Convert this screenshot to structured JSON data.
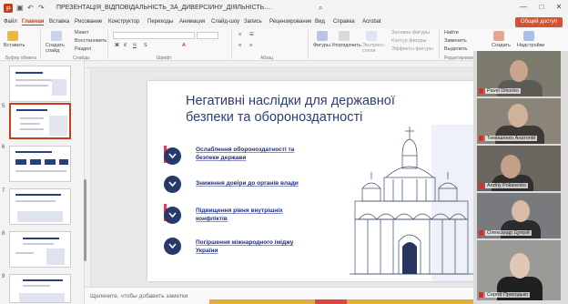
{
  "window": {
    "title": "ПРЕЗЕНТАЦІЯ_ВІДПОВІДАЛЬНІСТЬ_ЗА_ДИВЕРСІЙНУ_ДІЯЛЬНІСТЬ.pptx • PowerP..."
  },
  "tabs": [
    {
      "label": "Файл"
    },
    {
      "label": "Главная"
    },
    {
      "label": "Вставка"
    },
    {
      "label": "Рисование"
    },
    {
      "label": "Конструктор"
    },
    {
      "label": "Переходы"
    },
    {
      "label": "Анимация"
    },
    {
      "label": "Слайд-шоу"
    },
    {
      "label": "Запись"
    },
    {
      "label": "Рецензирование"
    },
    {
      "label": "Вид"
    },
    {
      "label": "Справка"
    },
    {
      "label": "Acrobat"
    }
  ],
  "share_label": "Общий доступ",
  "ribbon": {
    "paste": "Вставить",
    "new_slide": "Создать слайд",
    "layout": "Макет",
    "reset": "Восстановить",
    "section": "Раздел",
    "shapes": "Фигуры",
    "arrange": "Упорядочить",
    "express_styles": "Экспресс-стили",
    "shape_fill": "Заливка фигуры",
    "shape_outline": "Контур фигуры",
    "shape_effects": "Эффекты фигуры",
    "find": "Найти",
    "replace": "Заменить",
    "select": "Выделить",
    "create": "Создать",
    "addins": "Надстройки",
    "groups": {
      "clipboard": "Буфер обмена",
      "slides": "Слайды",
      "font": "Шрифт",
      "paragraph": "Абзац",
      "editing": "Редактирование"
    }
  },
  "thumbnails": [
    {
      "num": "5"
    },
    {
      "num": "6"
    },
    {
      "num": "7"
    },
    {
      "num": "8"
    },
    {
      "num": "9"
    }
  ],
  "slide": {
    "title": "Негативні наслідки для державної безпеки та обороноздатності",
    "items": [
      {
        "text": "Ослаблення обороноздатності та безпеки держави"
      },
      {
        "text": "Зниження довіри до органів влади"
      },
      {
        "text": "Підвищення рівня внутрішніх конфліктів"
      },
      {
        "text": "Погіршення міжнародного іміджу України"
      }
    ]
  },
  "notes_placeholder": "Щелкните, чтобы добавить заметки",
  "participants": [
    {
      "name": "Pavel Dikonko"
    },
    {
      "name": "Тимошенко Анатолій"
    },
    {
      "name": "Andriy Poliarenko"
    },
    {
      "name": "Олександр Цупрій"
    },
    {
      "name": "Сергій Приходько"
    }
  ],
  "colors": {
    "accent": "#c43e1c",
    "slide_navy": "#27386b",
    "title_navy": "#2d3e6f"
  }
}
